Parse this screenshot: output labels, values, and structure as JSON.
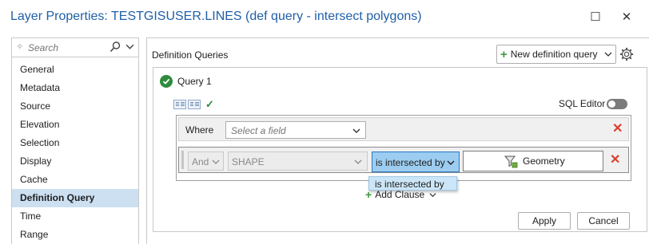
{
  "window": {
    "title": "Layer Properties: TESTGISUSER.LINES (def query - intersect polygons)",
    "maximize_glyph": "☐",
    "close_glyph": "✕"
  },
  "sidebar": {
    "search_placeholder": "Search",
    "items": [
      {
        "label": "General"
      },
      {
        "label": "Metadata"
      },
      {
        "label": "Source"
      },
      {
        "label": "Elevation"
      },
      {
        "label": "Selection"
      },
      {
        "label": "Display"
      },
      {
        "label": "Cache"
      },
      {
        "label": "Definition Query",
        "active": true
      },
      {
        "label": "Time"
      },
      {
        "label": "Range"
      }
    ]
  },
  "main": {
    "section_title": "Definition Queries",
    "new_definition_query_label": "New definition query",
    "query": {
      "name": "Query 1",
      "status": "valid",
      "sql_editor_label": "SQL Editor",
      "sql_editor_on": false,
      "where_label": "Where",
      "field_placeholder": "Select a field",
      "clause2": {
        "connector": "And",
        "field": "SHAPE",
        "operator": "is intersected by",
        "value_button": "Geometry"
      },
      "operator_dropdown_options": [
        "is intersected by"
      ],
      "add_clause_label": "Add Clause"
    },
    "apply_label": "Apply",
    "cancel_label": "Cancel"
  },
  "colors": {
    "title_blue": "#1f5fa8",
    "active_nav": "#cce0f2",
    "valid_green": "#2e8b3d",
    "delete_red": "#d93f2e",
    "operator_highlight": "#9ccdf0"
  }
}
